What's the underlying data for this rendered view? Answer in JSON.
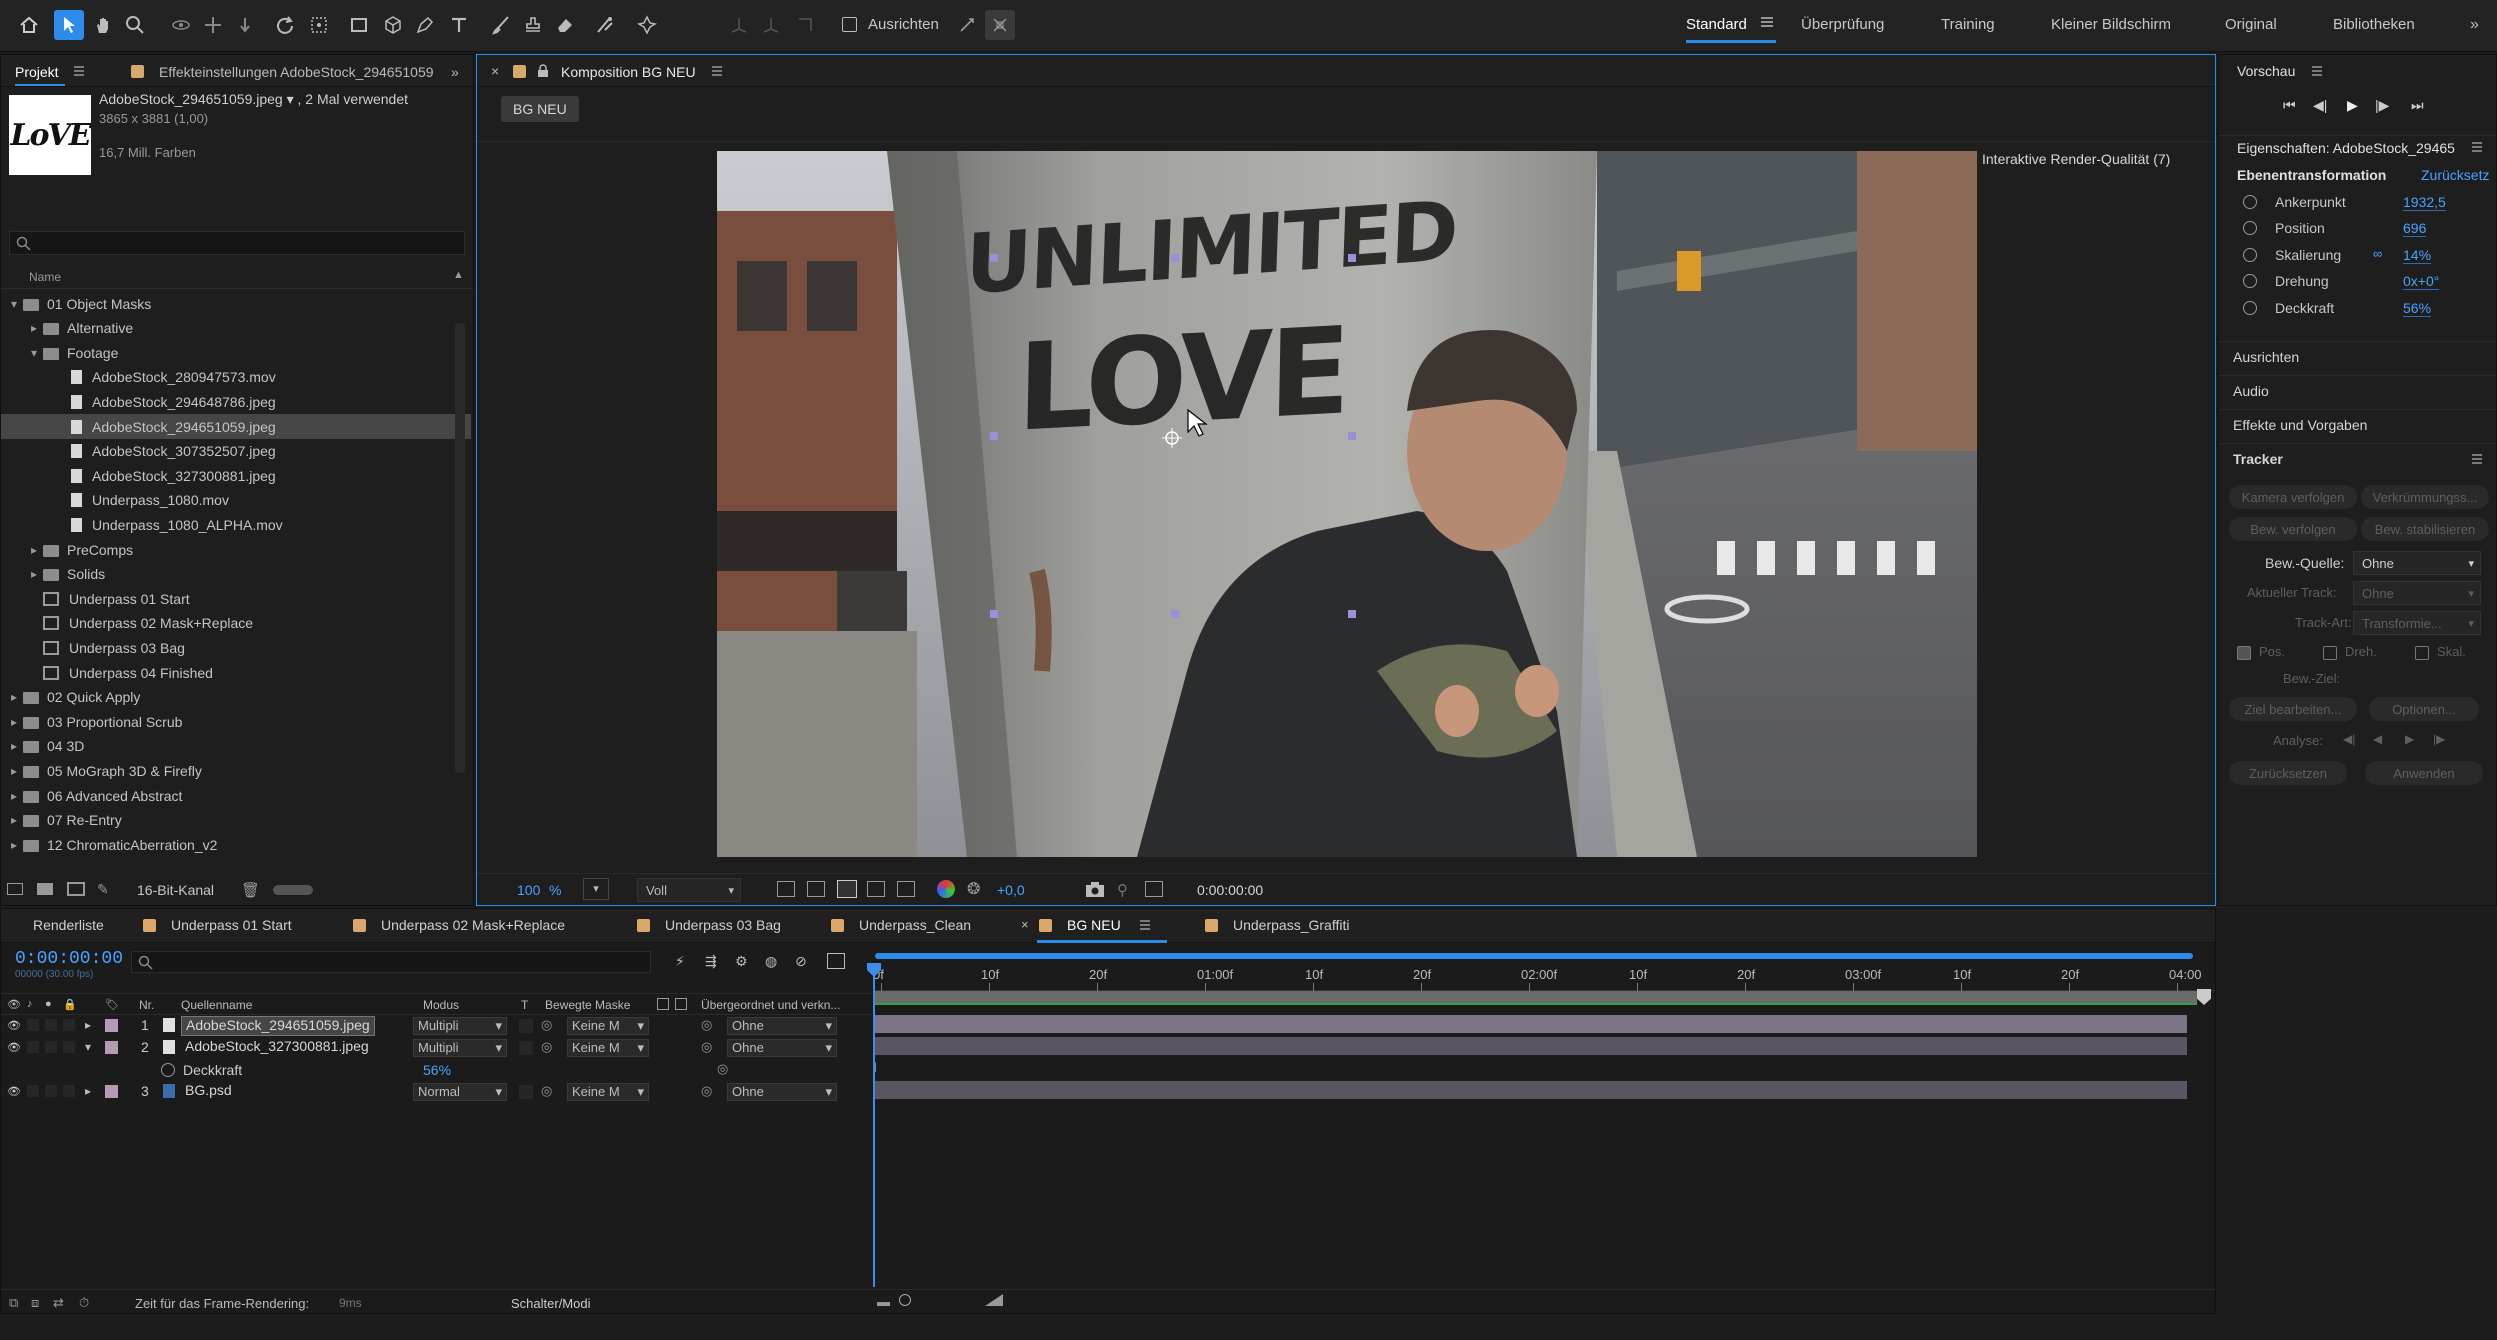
{
  "toolbar": {
    "align_label": "Ausrichten",
    "workspaces": [
      {
        "label": "Standard",
        "active": true
      },
      {
        "label": "Überprüfung"
      },
      {
        "label": "Training"
      },
      {
        "label": "Kleiner Bildschirm"
      },
      {
        "label": "Original"
      },
      {
        "label": "Bibliotheken"
      }
    ]
  },
  "project": {
    "tab_project": "Projekt",
    "tab_effects": "Effekteinstellungen AdobeStock_294651059",
    "file_name": "AdobeStock_294651059.jpeg ▾ , 2 Mal verwendet",
    "file_dims": "3865 x 3881 (1,00)",
    "file_colors": "16,7 Mill. Farben",
    "thumb_text": "LoVE",
    "column_name": "Name",
    "bit_depth": "16-Bit-Kanal",
    "tree": [
      {
        "label": "01 Object Masks",
        "type": "folder",
        "level": 0,
        "open": true
      },
      {
        "label": "Alternative",
        "type": "folder",
        "level": 1
      },
      {
        "label": "Footage",
        "type": "folder",
        "level": 1,
        "open": true
      },
      {
        "label": "AdobeStock_280947573.mov",
        "type": "file",
        "level": 2
      },
      {
        "label": "AdobeStock_294648786.jpeg",
        "type": "file",
        "level": 2
      },
      {
        "label": "AdobeStock_294651059.jpeg",
        "type": "file",
        "level": 2,
        "selected": true
      },
      {
        "label": "AdobeStock_307352507.jpeg",
        "type": "file",
        "level": 2
      },
      {
        "label": "AdobeStock_327300881.jpeg",
        "type": "file",
        "level": 2
      },
      {
        "label": "Underpass_1080.mov",
        "type": "file",
        "level": 2
      },
      {
        "label": "Underpass_1080_ALPHA.mov",
        "type": "file",
        "level": 2
      },
      {
        "label": "PreComps",
        "type": "folder",
        "level": 1
      },
      {
        "label": "Solids",
        "type": "folder",
        "level": 1
      },
      {
        "label": "Underpass 01 Start",
        "type": "comp",
        "level": 1
      },
      {
        "label": "Underpass 02 Mask+Replace",
        "type": "comp",
        "level": 1
      },
      {
        "label": "Underpass 03 Bag",
        "type": "comp",
        "level": 1
      },
      {
        "label": "Underpass 04 Finished",
        "type": "comp",
        "level": 1
      },
      {
        "label": "02 Quick Apply",
        "type": "folder",
        "level": 0
      },
      {
        "label": "03 Proportional Scrub",
        "type": "folder",
        "level": 0
      },
      {
        "label": "04 3D",
        "type": "folder",
        "level": 0
      },
      {
        "label": "05 MoGraph 3D & Firefly",
        "type": "folder",
        "level": 0
      },
      {
        "label": "06 Advanced Abstract",
        "type": "folder",
        "level": 0
      },
      {
        "label": "07 Re-Entry",
        "type": "folder",
        "level": 0
      },
      {
        "label": "12 ChromaticAberration_v2",
        "type": "folder",
        "level": 0
      }
    ]
  },
  "comp": {
    "tab_label": "Komposition BG NEU",
    "breadcrumb": "BG NEU",
    "render_quality": "Interaktive Render-Qualität (7)",
    "graffiti_top": "UNLIMITED",
    "graffiti_bottom": "LOVE",
    "zoom": "100",
    "zoom_unit": "%",
    "resolution": "Voll",
    "exposure": "+0,0",
    "timecode": "0:00:00:00"
  },
  "right_panel": {
    "preview_title": "Vorschau",
    "properties_title": "Eigenschaften: AdobeStock_29465",
    "transform_title": "Ebenentransformation",
    "reset_link": "Zurücksetz",
    "properties": [
      {
        "label": "Ankerpunkt",
        "value": "1932,5"
      },
      {
        "label": "Position",
        "value": "696"
      },
      {
        "label": "Skalierung",
        "value": "14%"
      },
      {
        "label": "Drehung",
        "value": "0x+0°"
      },
      {
        "label": "Deckkraft",
        "value": "56%"
      }
    ],
    "sections": [
      "Ausrichten",
      "Audio",
      "Effekte und Vorgaben"
    ],
    "tracker": {
      "title": "Tracker",
      "btn_track_camera": "Kamera verfolgen",
      "btn_warp": "Verkrümmungss...",
      "btn_track_motion": "Bew. verfolgen",
      "btn_stabilize": "Bew. stabilisieren",
      "source_label": "Bew.-Quelle:",
      "source_value": "Ohne",
      "current_track_label": "Aktueller Track:",
      "current_track_value": "Ohne",
      "track_type_label": "Track-Art:",
      "track_type_value": "Transformie...",
      "pos_label": "Pos.",
      "rot_label": "Dreh.",
      "scale_label": "Skal.",
      "target_label": "Bew.-Ziel:",
      "edit_target": "Ziel bearbeiten...",
      "options": "Optionen...",
      "analyze_label": "Analyse:",
      "reset": "Zurücksetzen",
      "apply": "Anwenden"
    }
  },
  "timeline": {
    "tabs": [
      {
        "label": "Renderliste",
        "color": ""
      },
      {
        "label": "Underpass 01 Start",
        "color": "#d9a86a"
      },
      {
        "label": "Underpass 02 Mask+Replace",
        "color": "#d9a86a"
      },
      {
        "label": "Underpass 03 Bag",
        "color": "#d9a86a"
      },
      {
        "label": "Underpass_Clean",
        "color": "#d9a86a"
      },
      {
        "label": "BG NEU",
        "color": "#d9a86a",
        "active": true
      },
      {
        "label": "Underpass_Graffiti",
        "color": "#d9a86a"
      }
    ],
    "timecode": "0:00:00:00",
    "timecode_sub": "00000 (30.00 fps)",
    "col_nr": "Nr.",
    "col_source": "Quellenname",
    "col_mode": "Modus",
    "col_t": "T",
    "col_trackmatte": "Bewegte Maske",
    "col_parent": "Übergeordnet und verkn...",
    "ruler": [
      "0f",
      "10f",
      "20f",
      "01:00f",
      "10f",
      "20f",
      "02:00f",
      "10f",
      "20f",
      "03:00f",
      "10f",
      "20f",
      "04:00"
    ],
    "layers": [
      {
        "nr": "1",
        "name": "AdobeStock_294651059.jpeg",
        "mode": "Multipli",
        "matte": "Keine M",
        "parent": "Ohne",
        "color": "#b69bb4",
        "selected": true
      },
      {
        "nr": "2",
        "name": "AdobeStock_327300881.jpeg",
        "mode": "Multipli",
        "matte": "Keine M",
        "parent": "Ohne",
        "color": "#b69bb4"
      },
      {
        "nr": "3",
        "name": "BG.psd",
        "mode": "Normal",
        "matte": "Keine M",
        "parent": "Ohne",
        "color": "#b69bb4"
      }
    ],
    "sub_prop_label": "Deckkraft",
    "sub_prop_value": "56%",
    "status_render_time": "Zeit für das Frame-Rendering:",
    "status_render_value": "9ms",
    "status_toggle": "Schalter/Modi"
  }
}
